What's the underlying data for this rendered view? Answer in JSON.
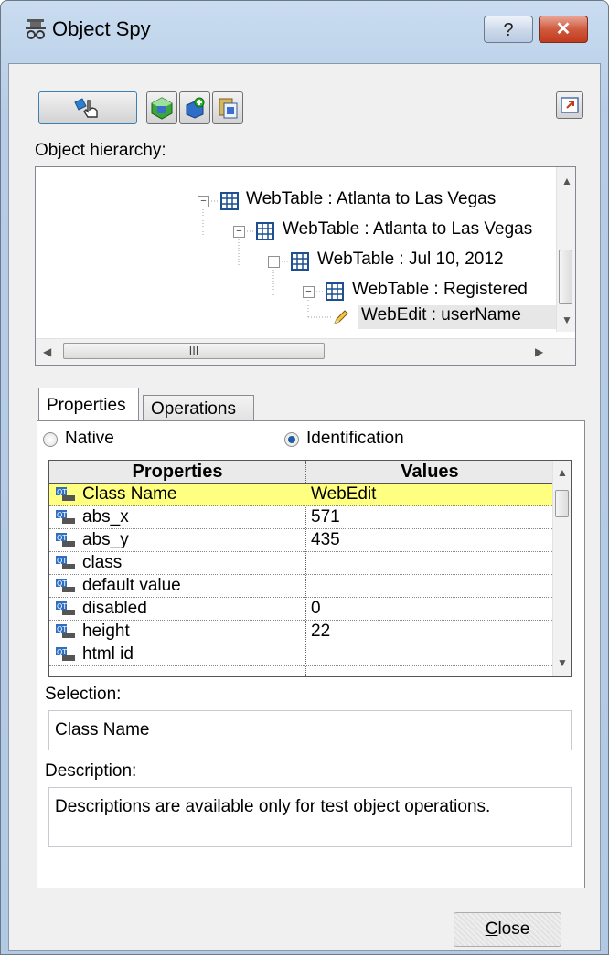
{
  "window": {
    "title": "Object Spy",
    "help_label": "?",
    "close_label": "✕"
  },
  "toolbar": {
    "buttons": [
      {
        "icon": "pointing-hand-icon"
      },
      {
        "icon": "add-object-icon"
      },
      {
        "icon": "add-objects-icon"
      },
      {
        "icon": "copy-icon"
      }
    ],
    "right_button_icon": "keep-on-top-icon"
  },
  "hierarchy": {
    "label": "Object hierarchy:",
    "nodes": [
      {
        "text": "WebTable : Atlanta to Las Vegas",
        "icon": "table-icon",
        "expander": "−"
      },
      {
        "text": "WebTable : Atlanta to Las Vegas",
        "icon": "table-icon",
        "expander": "−"
      },
      {
        "text": "WebTable : Jul 10, 2012",
        "icon": "table-icon",
        "expander": "−"
      },
      {
        "text": "WebTable : Registered",
        "icon": "table-icon",
        "expander": "−"
      },
      {
        "text": "WebEdit : userName",
        "icon": "pencil-icon",
        "selected": true
      }
    ],
    "hscroll_grip": "III"
  },
  "tabs": {
    "properties": "Properties",
    "operations": "Operations"
  },
  "mode": {
    "native": "Native",
    "identification": "Identification",
    "selected": "identification"
  },
  "grid": {
    "headers": {
      "properties": "Properties",
      "values": "Values"
    },
    "rows": [
      {
        "name": "Class Name",
        "value": "WebEdit",
        "highlight": true
      },
      {
        "name": "abs_x",
        "value": "571"
      },
      {
        "name": "abs_y",
        "value": "435"
      },
      {
        "name": "class",
        "value": ""
      },
      {
        "name": "default value",
        "value": ""
      },
      {
        "name": "disabled",
        "value": "0"
      },
      {
        "name": "height",
        "value": "22"
      },
      {
        "name": "html id",
        "value": ""
      }
    ]
  },
  "selection": {
    "label": "Selection:",
    "value": "Class Name"
  },
  "description": {
    "label": "Description:",
    "value": "Descriptions are available only for test object operations."
  },
  "buttons": {
    "close": "Close"
  }
}
